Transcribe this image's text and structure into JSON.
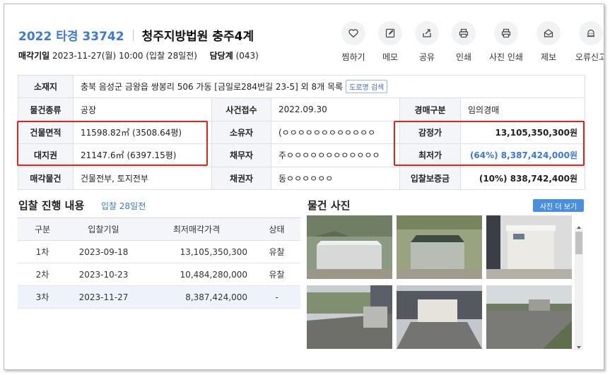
{
  "header": {
    "case_no": "2022 타경 33742",
    "court": "청주지방법원 충주4계",
    "sale_date_label": "매각기일",
    "sale_date_value": "2023-11-27(월) 10:00 (입찰 28일전)",
    "dept_label": "담당계",
    "dept_value": "(043)"
  },
  "actions": [
    {
      "label": "찜하기",
      "icon": "heart-icon"
    },
    {
      "label": "메모",
      "icon": "pencil-icon"
    },
    {
      "label": "공유",
      "icon": "share-icon"
    },
    {
      "label": "인쇄",
      "icon": "printer-icon"
    },
    {
      "label": "사진 인쇄",
      "icon": "photo-print-icon"
    },
    {
      "label": "제보",
      "icon": "mail-icon"
    },
    {
      "label": "오류신고",
      "icon": "alert-icon"
    }
  ],
  "info": {
    "location_label": "소재지",
    "location_value": "충북 음성군 금왕읍 쌍봉리 506 가동 [금일로284번길 23-5] 외 8개 목록",
    "road_search": "도로명 검색",
    "type_label": "물건종류",
    "type_value": "공장",
    "filed_label": "사건접수",
    "filed_value": "2022.09.30",
    "auction_kind_label": "경매구분",
    "auction_kind_value": "임의경매",
    "building_area_label": "건물면적",
    "building_area_value": "11598.82㎡ (3508.64평)",
    "owner_label": "소유자",
    "owner_value": "(ㅇㅇㅇㅇㅇㅇㅇㅇㅇㅇㅇㅇ",
    "appraisal_label": "감정가",
    "appraisal_value": "13,105,350,300원",
    "land_right_label": "대지권",
    "land_right_value": "21147.6㎡ (6397.15평)",
    "debtor_label": "채무자",
    "debtor_value": "주ㅇㅇㅇㅇㅇㅇㅇㅇㅇㅇㅇㅇ",
    "min_price_label": "최저가",
    "min_price_value": "(64%) 8,387,424,000원",
    "sale_item_label": "매각물건",
    "sale_item_value": "건물전부, 토지전부",
    "creditor_label": "채권자",
    "creditor_value": "동ㅇㅇㅇㅇㅇㅇ",
    "deposit_label": "입찰보증금",
    "deposit_value": "(10%) 838,742,400원"
  },
  "progress": {
    "title": "입찰 진행 내용",
    "subtitle": "입찰 28일전",
    "columns": [
      "구분",
      "입찰기일",
      "최저매각가격",
      "상태"
    ],
    "rows": [
      {
        "round": "1차",
        "date": "2023-09-18",
        "price": "13,105,350,300",
        "status": "유찰"
      },
      {
        "round": "2차",
        "date": "2023-10-23",
        "price": "10,484,280,000",
        "status": "유찰"
      },
      {
        "round": "3차",
        "date": "2023-11-27",
        "price": "8,387,424,000",
        "status": "-"
      }
    ]
  },
  "photos": {
    "title": "물건 사진",
    "more_button": "사진 더 보기"
  },
  "colors": {
    "accent": "#3c7ad6",
    "highlight_box": "#e2231a",
    "header_cell_bg": "#f3f5f8"
  }
}
